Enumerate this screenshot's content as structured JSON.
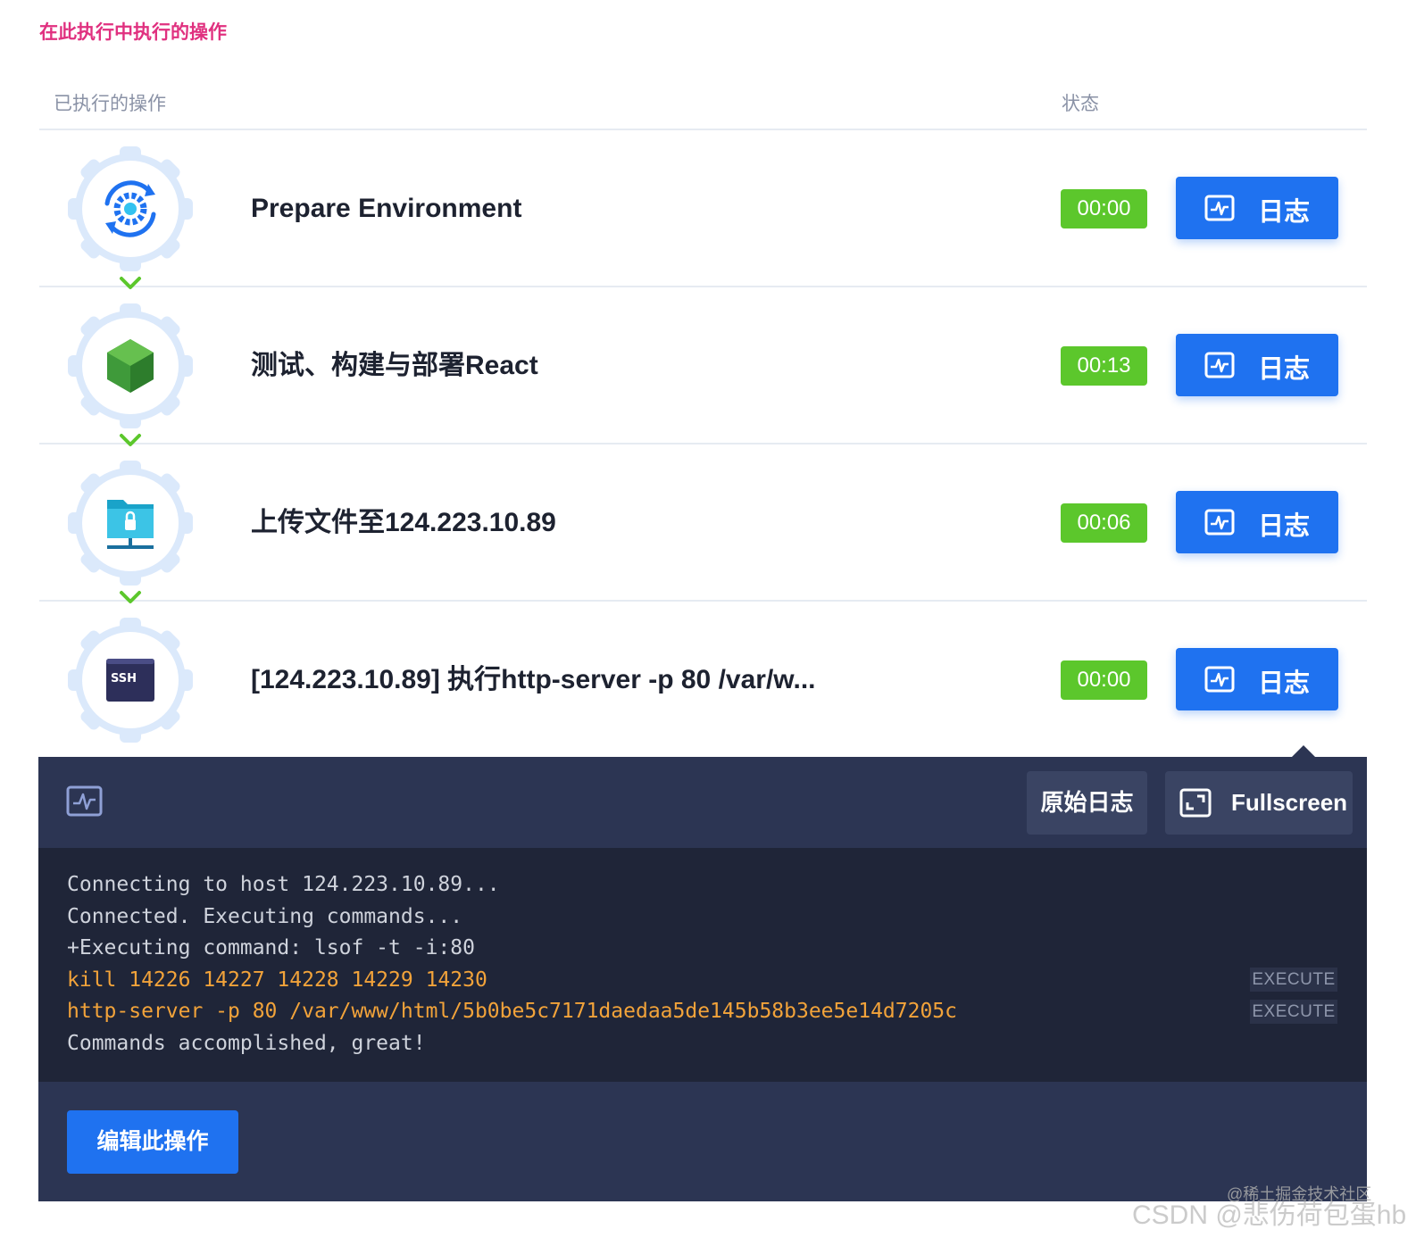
{
  "section_title": "在此执行中执行的操作",
  "table_header": {
    "operations": "已执行的操作",
    "status": "状态"
  },
  "steps": [
    {
      "title": "Prepare Environment",
      "time": "00:00",
      "log_label": "日志",
      "icon": "settings-sync-icon"
    },
    {
      "title": "测试、构建与部署React",
      "time": "00:13",
      "log_label": "日志",
      "icon": "nodejs-cube-icon"
    },
    {
      "title": "上传文件至124.223.10.89",
      "time": "00:06",
      "log_label": "日志",
      "icon": "upload-folder-icon"
    },
    {
      "title": "[124.223.10.89] 执行http-server -p 80 /var/w...",
      "time": "00:00",
      "log_label": "日志",
      "icon": "ssh-terminal-icon"
    }
  ],
  "log_panel": {
    "raw_log_label": "原始日志",
    "fullscreen_label": "Fullscreen",
    "lines": [
      "Connecting to host 124.223.10.89...",
      "Connected. Executing commands...",
      "+Executing command: lsof -t -i:80",
      "kill 14226 14227 14228 14229 14230",
      "http-server -p 80 /var/www/html/5b0be5c7171daedaa5de145b58b3ee5e14d7205c",
      "Commands accomplished, great!"
    ],
    "execute_tag": "EXECUTE",
    "edit_label": "编辑此操作"
  },
  "watermarks": {
    "top": "@稀土掘金技术社区",
    "bottom": "CSDN @悲伤荷包蛋hb"
  },
  "colors": {
    "accent_blue": "#1f72f0",
    "success_green": "#5cc72c",
    "title_pink": "#e0307f",
    "panel_bg": "#2c3553",
    "console_bg": "#1f2538",
    "command_highlight": "#f2a33a"
  }
}
